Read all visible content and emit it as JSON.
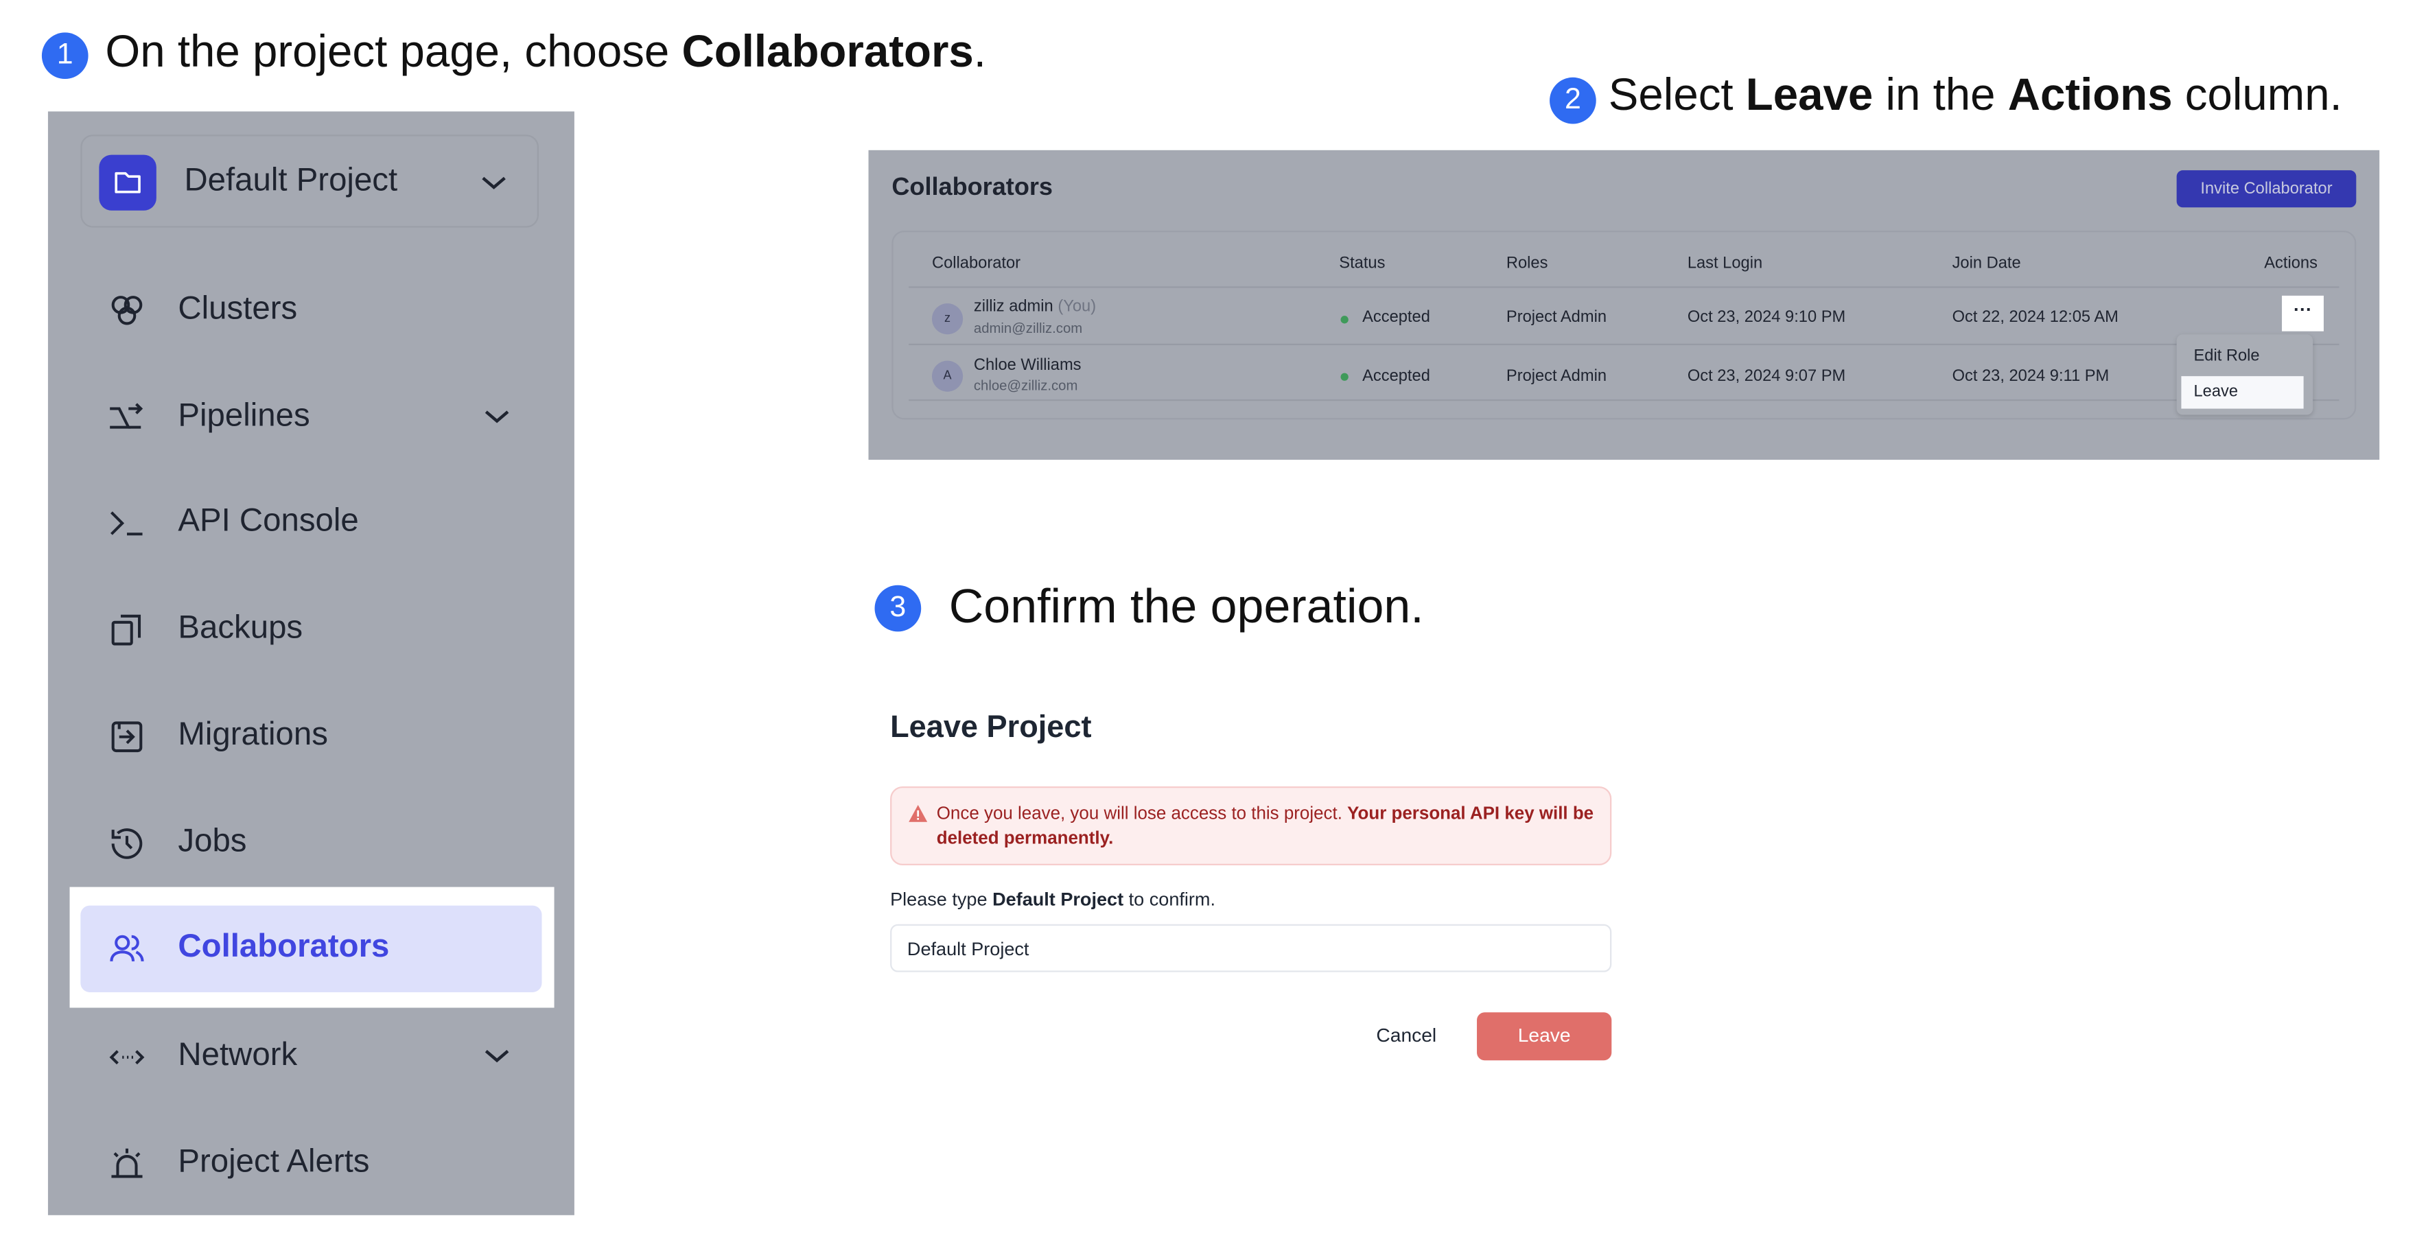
{
  "steps": [
    {
      "num": "1",
      "pre": "On the project page, choose ",
      "bold": "Collaborators",
      "post": "."
    },
    {
      "num": "2",
      "pre": "Select ",
      "bold": "Leave",
      "mid": " in the ",
      "bold2": "Actions",
      "post": " column."
    },
    {
      "num": "3",
      "text": "Confirm the operation."
    }
  ],
  "sidebar": {
    "project": "Default Project",
    "items": [
      {
        "label": "Clusters",
        "icon": "clusters-icon"
      },
      {
        "label": "Pipelines",
        "icon": "pipelines-icon",
        "chevron": true
      },
      {
        "label": "API Console",
        "icon": "terminal-icon"
      },
      {
        "label": "Backups",
        "icon": "backups-icon"
      },
      {
        "label": "Migrations",
        "icon": "migrations-icon"
      },
      {
        "label": "Jobs",
        "icon": "history-icon"
      },
      {
        "label": "Collaborators",
        "icon": "users-icon",
        "active": true
      },
      {
        "label": "Network",
        "icon": "network-icon",
        "chevron": true
      },
      {
        "label": "Project Alerts",
        "icon": "alarm-icon"
      }
    ]
  },
  "collaborators": {
    "title": "Collaborators",
    "invite": "Invite Collaborator",
    "columns": [
      "Collaborator",
      "Status",
      "Roles",
      "Last Login",
      "Join Date",
      "Actions"
    ],
    "rows": [
      {
        "avatar": "z",
        "name": "zilliz admin",
        "you": "(You)",
        "email": "admin@zilliz.com",
        "status": "Accepted",
        "role": "Project Admin",
        "last_login": "Oct 23, 2024 9:10 PM",
        "join": "Oct 22, 2024 12:05 AM"
      },
      {
        "avatar": "A",
        "name": "Chloe Williams",
        "email": "chloe@zilliz.com",
        "status": "Accepted",
        "role": "Project Admin",
        "last_login": "Oct 23, 2024 9:07 PM",
        "join": "Oct 23, 2024 9:11 PM"
      }
    ],
    "more": "···",
    "menu": [
      "Edit Role",
      "Leave"
    ]
  },
  "dialog": {
    "title": "Leave Project",
    "warning": "Once you leave, you will lose access to this project. ",
    "warning_bold": "Your personal API key will be deleted permanently.",
    "confirm_pre": "Please type ",
    "confirm_bold": "Default Project",
    "confirm_post": " to confirm.",
    "input_value": "Default Project",
    "cancel": "Cancel",
    "leave": "Leave"
  },
  "colors": {
    "accent": "#2f6bf2",
    "brand": "#3a3fcf",
    "danger": "#e06f6a",
    "active_text": "#4046e0"
  }
}
